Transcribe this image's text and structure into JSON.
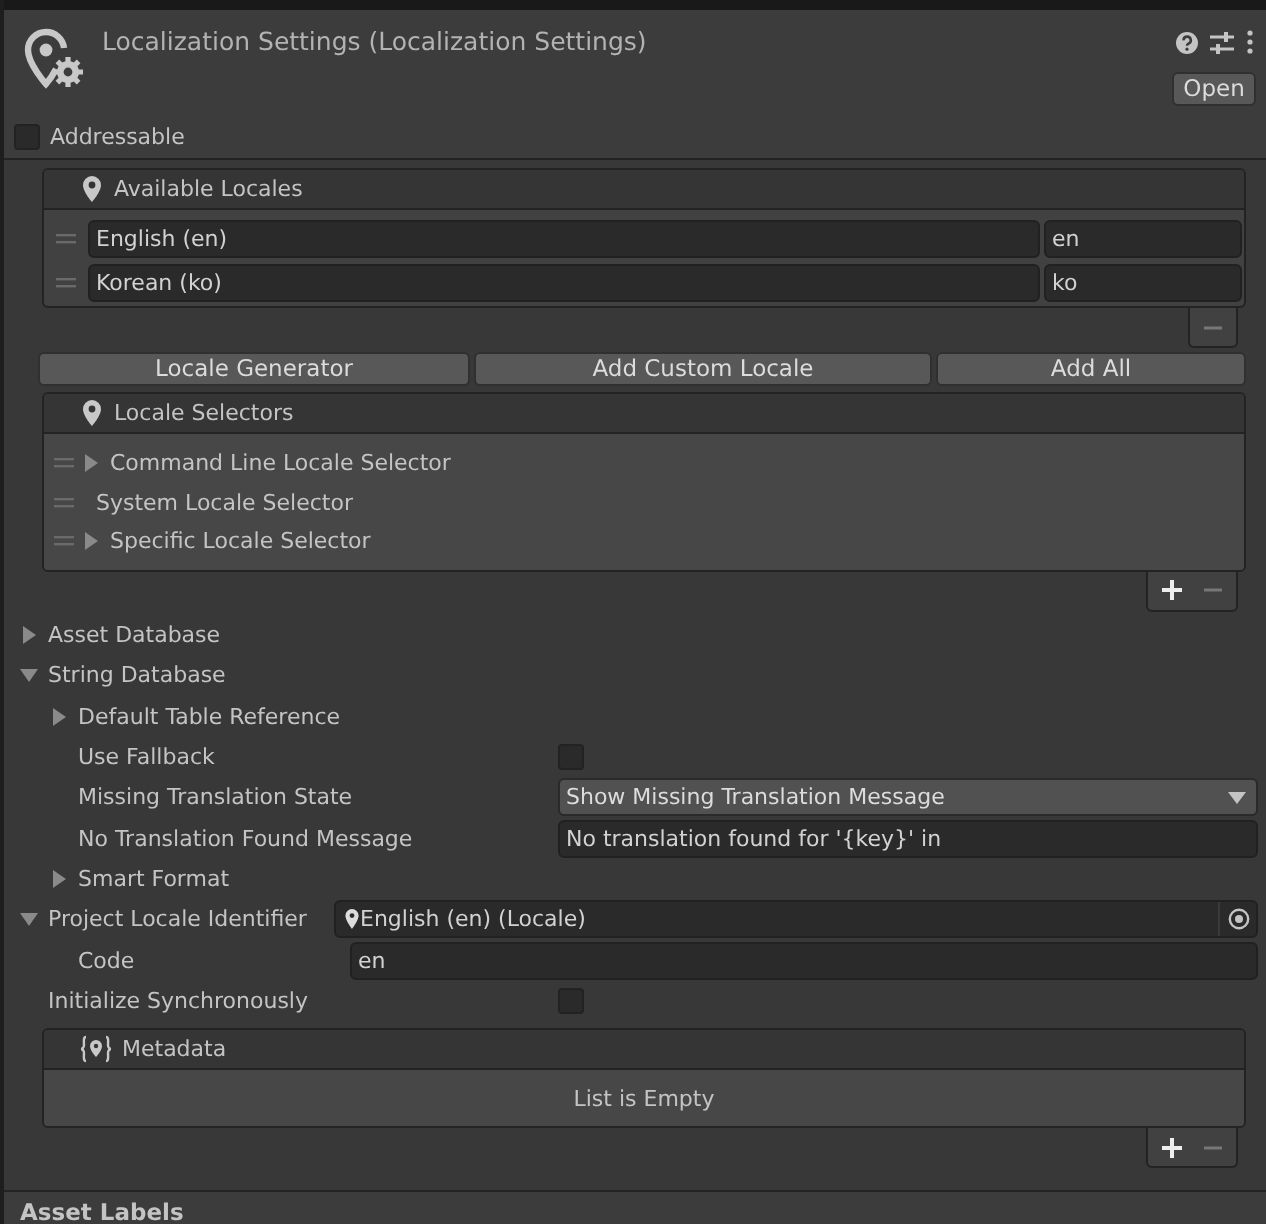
{
  "inspector": {
    "title": "Localization Settings (Localization Settings)",
    "open_button": "Open",
    "addressable": {
      "label": "Addressable",
      "checked": false
    }
  },
  "available_locales": {
    "title": "Available Locales",
    "items": [
      {
        "name": "English (en)",
        "code": "en"
      },
      {
        "name": "Korean (ko)",
        "code": "ko"
      }
    ]
  },
  "locale_buttons": [
    "Locale Generator",
    "Add Custom Locale",
    "Add All"
  ],
  "locale_selectors": {
    "title": "Locale Selectors",
    "items": [
      {
        "label": "Command Line Locale Selector",
        "expandable": true
      },
      {
        "label": "System Locale Selector",
        "expandable": false
      },
      {
        "label": "Specific Locale Selector",
        "expandable": true
      }
    ]
  },
  "properties": [
    {
      "kind": "foldout",
      "label": "Asset Database",
      "expanded": false
    },
    {
      "kind": "foldout",
      "label": "String Database",
      "expanded": true,
      "children": [
        {
          "kind": "foldout",
          "label": "Default Table Reference",
          "expanded": false
        },
        {
          "kind": "checkbox",
          "label": "Use Fallback",
          "checked": false
        },
        {
          "kind": "dropdown",
          "label": "Missing Translation State",
          "value": "Show Missing Translation Message"
        },
        {
          "kind": "text",
          "label": "No Translation Found Message",
          "value": "No translation found for '{key}' in"
        },
        {
          "kind": "foldout",
          "label": "Smart Format",
          "expanded": false
        }
      ]
    },
    {
      "kind": "object",
      "label": "Project Locale Identifier",
      "expanded": true,
      "value": "English (en) (Locale)",
      "children": [
        {
          "kind": "text",
          "label": "Code",
          "value": "en"
        }
      ]
    },
    {
      "kind": "checkbox",
      "label": "Initialize Synchronously",
      "checked": false
    }
  ],
  "metadata": {
    "title": "Metadata",
    "empty_text": "List is Empty"
  },
  "asset_labels": "Asset Labels"
}
